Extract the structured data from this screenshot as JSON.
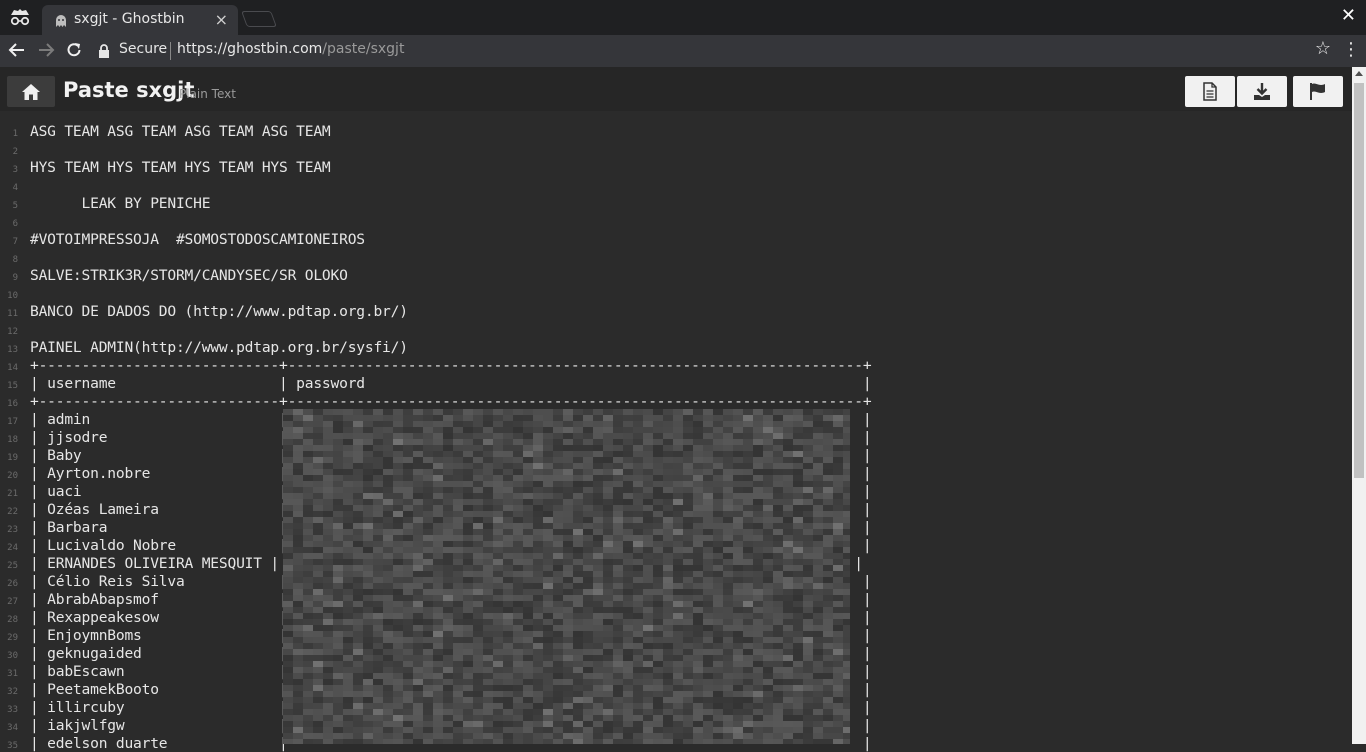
{
  "browser": {
    "tab_title": "sxgjt - Ghostbin",
    "tab_close": "×",
    "window_close": "✕",
    "secure_label": "Secure",
    "url_host": "https://ghostbin.com",
    "url_path": "/paste/sxgjt"
  },
  "header": {
    "title": "Paste sxgjt",
    "type": "Plain Text"
  },
  "lines": [
    "ASG TEAM ASG TEAM ASG TEAM ASG TEAM",
    "",
    "HYS TEAM HYS TEAM HYS TEAM HYS TEAM",
    "",
    "      LEAK BY PENICHE",
    "",
    "#VOTOIMPRESSOJA  #SOMOSTODOSCAMIONEIROS",
    "",
    "SALVE:STRIK3R/STORM/CANDYSEC/SR OLOKO",
    "",
    "BANCO DE DADOS DO (http://www.pdtap.org.br/)",
    "",
    "PAINEL ADMIN(http://www.pdtap.org.br/sysfi/)",
    "+----------------------------+-------------------------------------------------------------------+",
    "| username                   | password                                                          |",
    "+----------------------------+-------------------------------------------------------------------+",
    "| admin                      |                                                                   |",
    "| jjsodre                    |                                                                   |",
    "| Baby                       |                                                                   |",
    "| Ayrton.nobre               |                                                                   |",
    "| uaci                       |                                                                   |",
    "| Ozéas Lameira              |                                                                   |",
    "| Barbara                    |                                                                   |",
    "| Lucivaldo Nobre            |                                                                   |",
    "| ERNANDES OLIVEIRA MESQUIT |                                                                   |",
    "| Célio Reis Silva           |                                                                   |",
    "| AbrabAbapsmof              |                                                                   |",
    "| Rexappeakesow              |                                                                   |",
    "| EnjoymnBoms                |                                                                   |",
    "| geknugaided                |                                                                   |",
    "| babEscawn                  |                                                                   |",
    "| PeetamekBooto              |                                                                   |",
    "| illircuby                  |                                                                   |",
    "| iakjwlfgw                  |                                                                   |",
    "| edelson duarte             |                                                                   |"
  ]
}
